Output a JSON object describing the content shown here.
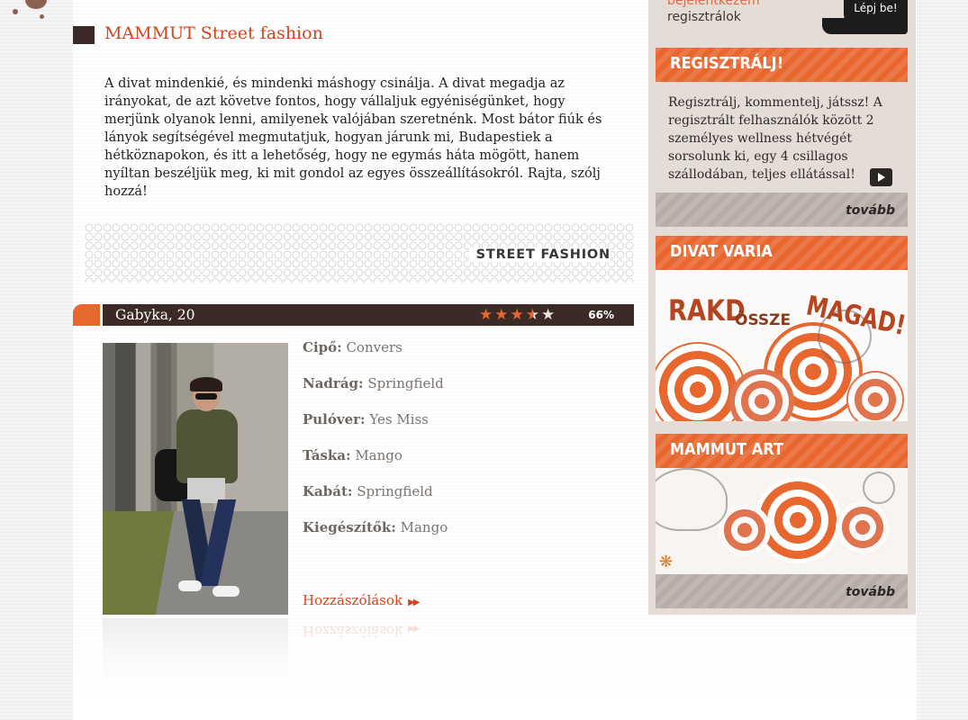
{
  "main": {
    "section_title": "MAMMUT Street fashion",
    "intro": "A divat mindenkié, és mindenki máshogy csinálja. A divat megadja az irányokat, de azt követve fontos, hogy vállaljuk egyéniségünket, hogy merjünk olyanok lenni, amilyenek valójában szeretnénk. Most bátor fiúk és lányok segítségével megmutatjuk, hogyan járunk mi, Budapestiek a hétköznapokon, és itt a lehetőség, hogy ne egymás háta mögött, hanem nyíltan beszéljük meg, ki mit gondol az egyes összeállításokról. Rajta, szólj hozzá!",
    "banner_label": "STREET FASHION",
    "person": {
      "name": "Gabyka, 20",
      "rating_percent": "66%",
      "rating_stars": 3.5,
      "stars_total": 5
    },
    "details": [
      {
        "key": "Cipő:",
        "value": "Convers"
      },
      {
        "key": "Nadrág:",
        "value": "Springfield"
      },
      {
        "key": "Pulóver:",
        "value": "Yes Miss"
      },
      {
        "key": "Táska:",
        "value": "Mango"
      },
      {
        "key": "Kabát:",
        "value": "Springfield"
      },
      {
        "key": "Kiegészítők:",
        "value": "Mango"
      }
    ],
    "comments_link": "Hozzászólások"
  },
  "sidebar": {
    "login_link": "bejelentkezem",
    "register_link": "regisztrálok",
    "login_button": "Lépj be!",
    "register_box": {
      "title": "REGISZTRÁLJ!",
      "text": "Regisztrálj, kommentelj, játssz! A regisztrált felhasználók között 2 személyes wellness hétvégét sorsolunk ki, egy 4 csillagos szállodában, teljes ellátással!",
      "more": "tovább"
    },
    "varia_box": {
      "title": "DIVAT VARIA",
      "promo_words": [
        "RAKD",
        "ÖSSZE",
        "MAGAD!"
      ]
    },
    "art_box": {
      "title": "MAMMUT ART",
      "more": "tovább"
    }
  },
  "colors": {
    "accent": "#e8672e",
    "title_red": "#d4431c",
    "dark_bar": "#3b2a26",
    "sidebar_bg": "#e6dcd7"
  }
}
